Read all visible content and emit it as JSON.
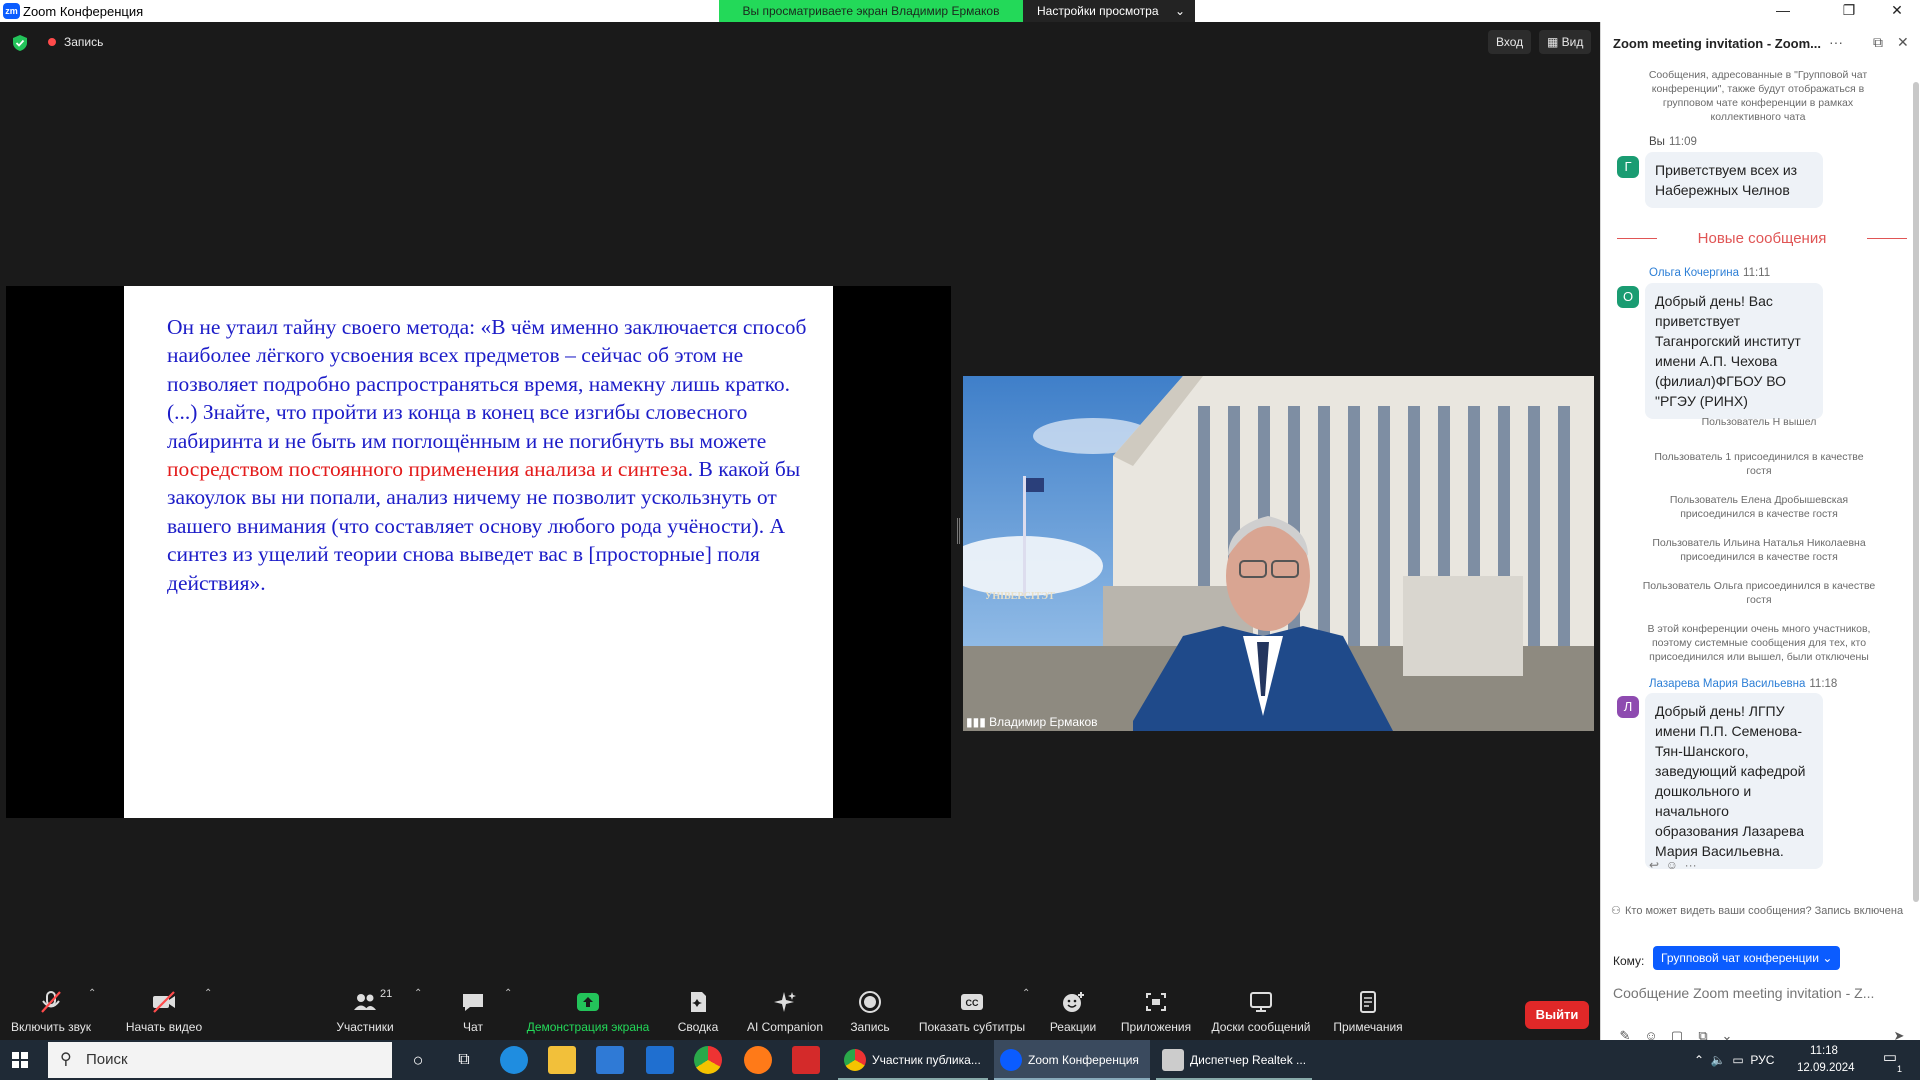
{
  "window": {
    "app_title": "Zoom Конференция"
  },
  "share_banner": {
    "text": "Вы просматриваете экран Владимир Ермаков",
    "settings_label": "Настройки просмотра"
  },
  "top_bar": {
    "recording_label": "Запись",
    "signin_label": "Вход",
    "view_label": "Вид"
  },
  "slide": {
    "part1": "Он не утаил тайну своего метода: «В чём именно заключается способ наиболее лёгкого усвоения всех предметов – сейчас об этом не позволяет подробно распространяться время, намекну лишь кратко. (...) Знайте, что пройти из конца в конец все изгибы словесного лабиринта и не быть им поглощённым и не погибнуть вы можете ",
    "highlight": "посредством постоянного применения анализа и синтеза",
    "part2": ". В какой бы закоулок вы ни попали, анализ ничему не позволит ускользнуть от вашего внимания (что составляет основу любого рода учёности). А синтез из ущелий теории снова выведет вас в [просторные] поля действия»."
  },
  "video": {
    "speaker_name": "Владимир Ермаков",
    "sign_text": "УНІВЕРСІТЭТ"
  },
  "toolbar": {
    "mute_label": "Включить звук",
    "video_label": "Начать видео",
    "participants_label": "Участники",
    "participants_count": "21",
    "chat_label": "Чат",
    "share_label": "Демонстрация экрана",
    "summary_label": "Сводка",
    "ai_label": "AI Companion",
    "record_label": "Запись",
    "captions_label": "Показать субтитры",
    "reactions_label": "Реакции",
    "apps_label": "Приложения",
    "boards_label": "Доски сообщений",
    "notes_label": "Примечания",
    "leave_label": "Выйти"
  },
  "chat": {
    "title": "Zoom meeting invitation - Zoom...",
    "notice": "Сообщения, адресованные в \"Групповой чат конференции\", также будут отображаться в групповом чате конференции в рамках коллективного чата",
    "messages": [
      {
        "sender": "Вы",
        "time": "11:09",
        "initial": "Г",
        "color": "#1a9c72",
        "text": "Приветствуем всех из Набережных Челнов"
      },
      {
        "sender": "Ольга Кочергина",
        "time": "11:11",
        "initial": "О",
        "color": "#1a9c72",
        "text": "Добрый день! Вас приветствует Таганрогский институт имени А.П. Чехова (филиал)ФГБОУ ВО \"РГЭУ (РИНХ)"
      },
      {
        "sender": "Лазарева Мария Васильевна",
        "time": "11:18",
        "initial": "Л",
        "color": "#8e4bb0",
        "text": "Добрый день! ЛГПУ имени П.П. Семенова-Тян-Шанского, заведующий кафедрой дошкольного и начального образования Лазарева Мария Васильевна."
      }
    ],
    "new_messages_label": "Новые сообщения",
    "system": [
      "Пользователь Н вышел",
      "Пользователь 1 присоединился в качестве гостя",
      "Пользователь Елена Дробышевская присоединился в качестве гостя",
      "Пользователь Ильина Наталья Николаевна присоединился в качестве гостя",
      "Пользователь Ольга присоединился в качестве гостя",
      "В этой конференции очень много участников, поэтому системные сообщения для тех, кто присоединился или вышел, были отключены"
    ],
    "privacy_text": "Кто может видеть ваши сообщения? Запись включена",
    "to_label": "Кому:",
    "to_value": "Групповой чат конференции",
    "input_placeholder": "Сообщение Zoom meeting invitation - Z..."
  },
  "taskbar": {
    "search_placeholder": "Поиск",
    "tasks": [
      "Участник публика...",
      "Zoom Конференция",
      "Диспетчер Realtek ..."
    ],
    "lang": "РУС",
    "time": "11:18",
    "date": "12.09.2024",
    "notif_count": "1"
  },
  "colors": {
    "accent": "#0b5cff",
    "share_green": "#23d959",
    "leave_red": "#e02828",
    "slide_blue": "#1c1cc8",
    "slide_red": "#e31b1b"
  }
}
